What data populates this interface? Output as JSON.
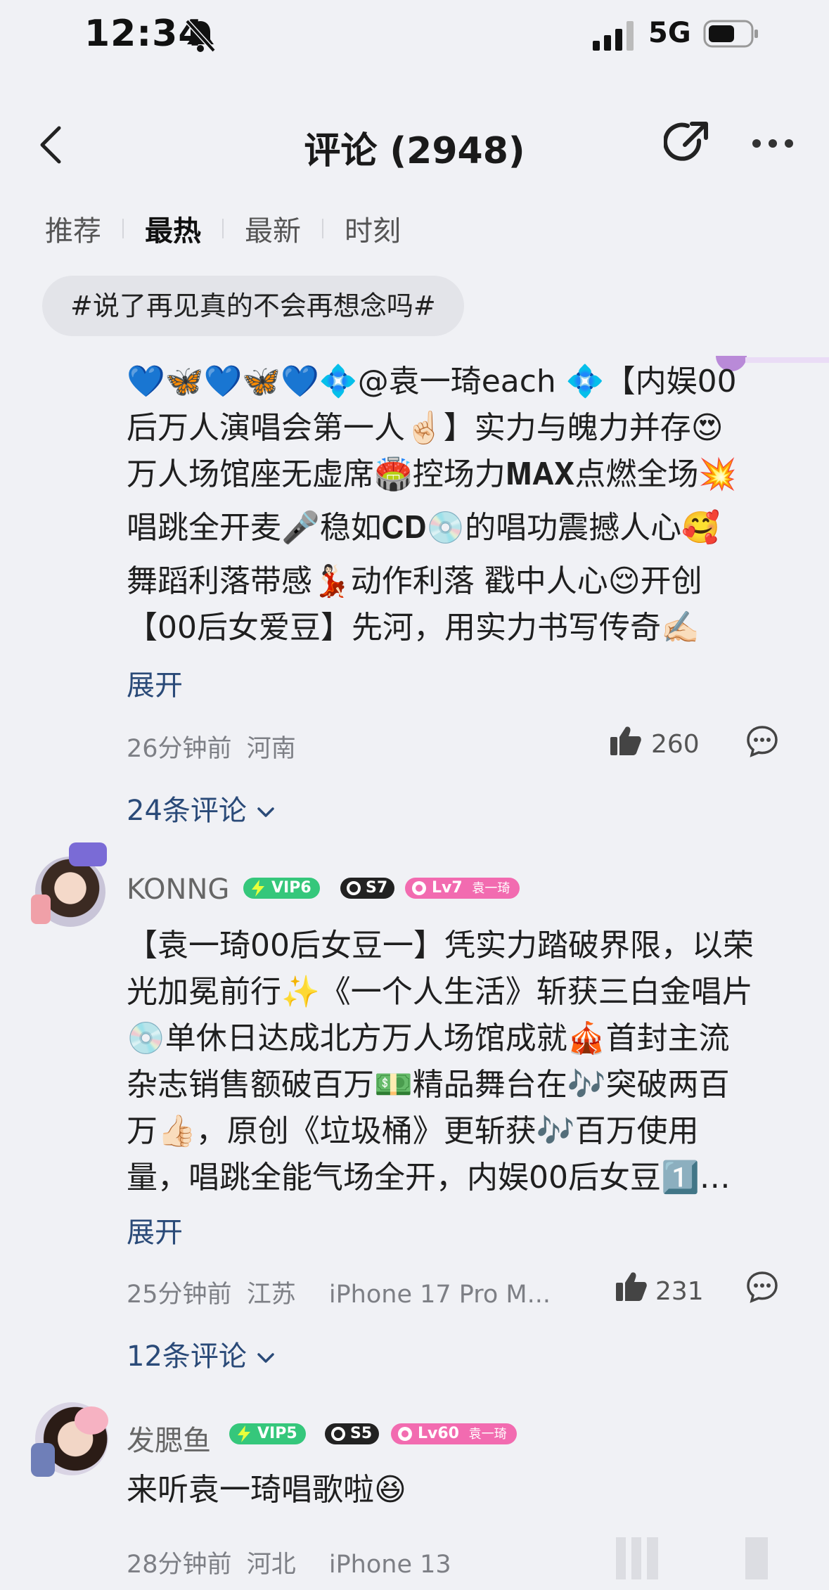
{
  "status_bar": {
    "time": "12:34",
    "network": "5G"
  },
  "header": {
    "title": "评论 (2948)"
  },
  "tabs": [
    {
      "label": "推荐",
      "active": false
    },
    {
      "label": "最热",
      "active": true
    },
    {
      "label": "最新",
      "active": false
    },
    {
      "label": "时刻",
      "active": false
    }
  ],
  "topic": "#说了再见真的不会再想念吗#",
  "comments": [
    {
      "text_lines": [
        "💙🦋💙🦋💙💠@袁一琦each 💠【内娱00",
        "后万人演唱会第一人☝🏻】实力与魄力并存😍",
        "万人场馆座无虚席🏟️控场力𝐌𝐀𝐗点燃全场💥",
        "唱跳全开麦🎤稳如𝐂𝐃💿的唱功震撼人心🥰",
        "舞蹈利落带感💃🏻动作利落 戳中人心😌开创",
        "【00后女爱豆】先河，用实力书写传奇✍🏻"
      ],
      "expand": "展开",
      "time": "26分钟前",
      "location": "河南",
      "likes": "260",
      "replies": "24条评论"
    },
    {
      "username": "KONNG",
      "vip": "VIP6",
      "s_badge": "S7",
      "level": "Lv7",
      "fan_tag": "袁一琦",
      "text_lines": [
        "【袁一琦00后女豆一】凭实力踏破界限，以荣",
        "光加冕前行✨《一个人生活》斩获三白金唱片",
        "💿单休日达成北方万人场馆成就🎪首封主流",
        "杂志销售额破百万💵精品舞台在🎶突破两百",
        "万👍🏻，原创《垃圾桶》更斩获🎶百万使用",
        "量，唱跳全能气场全开，内娱00后女豆1️⃣…"
      ],
      "expand": "展开",
      "time": "25分钟前",
      "location": "江苏",
      "device": "iPhone 17 Pro M...",
      "likes": "231",
      "replies": "12条评论"
    },
    {
      "username": "发腮鱼",
      "vip": "VIP5",
      "s_badge": "S5",
      "level": "Lv60",
      "fan_tag": "袁一琦",
      "text": "来听袁一琦唱歌啦😆",
      "time": "28分钟前",
      "location": "河北",
      "device": "iPhone 13"
    }
  ],
  "colors": {
    "background": "#f0f1f5",
    "link": "#2a4a78",
    "vip": "#35c77b",
    "level": "#f26bb0"
  }
}
